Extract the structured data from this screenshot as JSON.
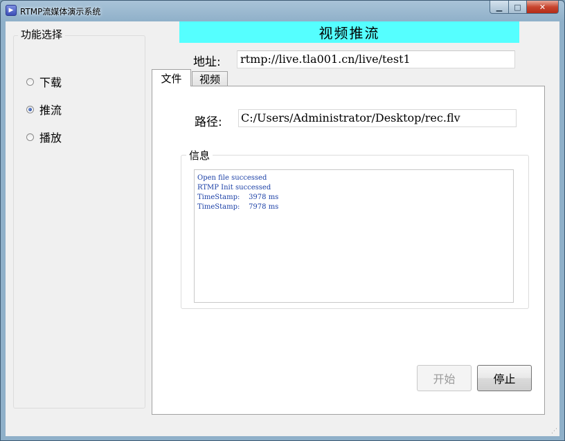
{
  "window": {
    "title": "RTMP流媒体演示系统",
    "minimize_glyph": "▁",
    "maximize_glyph": "□",
    "close_glyph": "✕"
  },
  "function_group": {
    "legend": "功能选择",
    "options": [
      {
        "label": "下载",
        "selected": false
      },
      {
        "label": "推流",
        "selected": true
      },
      {
        "label": "播放",
        "selected": false
      }
    ]
  },
  "header": {
    "banner": "视频推流",
    "address_label": "地址:",
    "address_value": "rtmp://live.tla001.cn/live/test1"
  },
  "tabs": [
    {
      "label": "文件",
      "active": true
    },
    {
      "label": "视频",
      "active": false
    }
  ],
  "file_tab": {
    "path_label": "路径:",
    "path_value": "C:/Users/Administrator/Desktop/rec.flv",
    "info_legend": "信息",
    "log_lines": [
      "Open file successed",
      "RTMP Init successed",
      "TimeStamp:    3978 ms",
      "TimeStamp:    7978 ms"
    ]
  },
  "buttons": {
    "start_label": "开始",
    "start_enabled": false,
    "stop_label": "停止"
  },
  "colors": {
    "banner": "#55ffff",
    "log_text": "#1a3fa6"
  }
}
